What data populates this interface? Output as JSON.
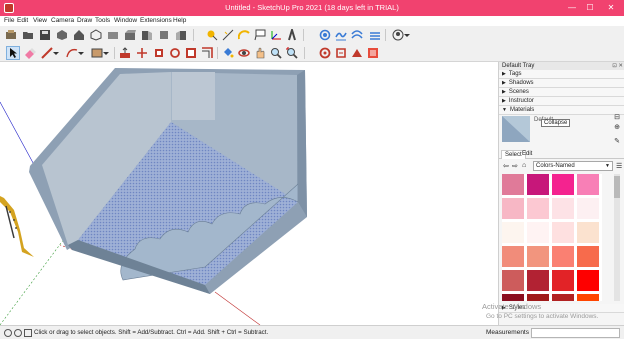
{
  "window": {
    "title": "Untitled - SketchUp Pro 2021 (18 days left in TRIAL)",
    "minimize": "—",
    "maximize": "☐",
    "close": "✕"
  },
  "menu": [
    "File",
    "Edit",
    "View",
    "Camera",
    "Draw",
    "Tools",
    "Window",
    "Extensions",
    "Help"
  ],
  "tray": {
    "title": "Default Tray",
    "pins": "⊡ ✕",
    "panels": {
      "tags": "Tags",
      "shadows": "Shadows",
      "scenes": "Scenes",
      "instructor": "Instructor",
      "materials": "Materials",
      "styles": "Styles"
    },
    "material_name": "Default",
    "tooltip": "Collapse",
    "tabs": {
      "select": "Select",
      "edit": "Edit"
    },
    "collection": "Colors-Named",
    "swatch_colors": [
      "#e07a99",
      "#c7177a",
      "#f4238f",
      "#f87fb6",
      "#f7b7c5",
      "#fcc8d2",
      "#fde2e6",
      "#fdf0f2",
      "#fdf5ef",
      "#fff3f3",
      "#fee0e0",
      "#fbe2cf",
      "#f18c7a",
      "#f2957e",
      "#fa8072",
      "#f76b4c",
      "#cd5c5c",
      "#b22233",
      "#e22327",
      "#fe0000",
      "#8b0e1f",
      "#a01a1a",
      "#b22222",
      "#ff4500"
    ]
  },
  "status": {
    "text": "Click or drag to select objects. Shift = Add/Subtract. Ctrl = Add. Shift + Ctrl = Subtract.",
    "measurements_label": "Measurements"
  },
  "watermark": {
    "line1": "Activate Windows",
    "line2": "Go to PC settings to activate Windows."
  },
  "colors": {
    "title_bar": "#f1426f",
    "wall": "#a8b8c9",
    "floor_pattern": "#8ea2d2",
    "accent": "#3a7bd5"
  }
}
